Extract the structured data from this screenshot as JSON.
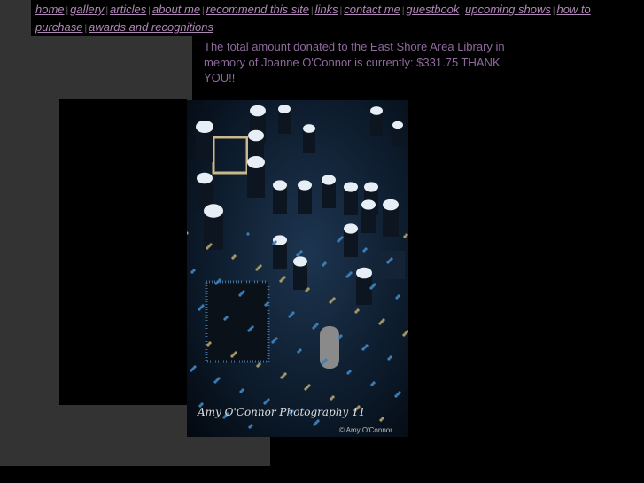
{
  "nav": {
    "items": [
      "home",
      "gallery",
      "articles",
      "about me",
      "recommend this site",
      "links",
      "contact me",
      "guestbook",
      "upcoming shows",
      "how to purchase",
      "awards and recognitions"
    ],
    "separator": "|"
  },
  "message": "The total amount donated to the East Shore Area Library in memory of Joanne O'Connor is currently: $331.75 THANK YOU!!",
  "photo": {
    "signature": "Amy O'Connor Photography 11",
    "copyright": "© Amy O'Connor"
  },
  "colors": {
    "link": "#b088b8",
    "text": "#8e6a9c",
    "panel": "#333333",
    "background": "#000000"
  }
}
